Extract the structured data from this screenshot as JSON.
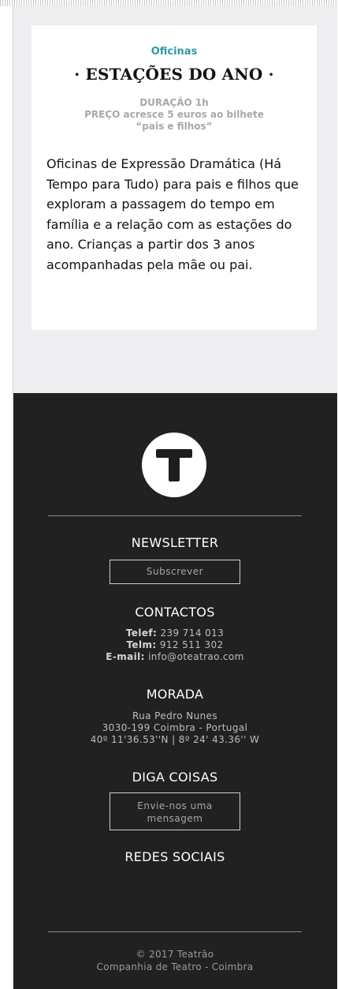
{
  "event": {
    "category": "Oficinas",
    "title": "· ESTAÇÕES DO ANO ·",
    "duration": "DURAÇÃO 1h",
    "price": "PREÇO acresce 5 euros ao bilhete",
    "price_note": "“pais e  filhos”",
    "description": "Oficinas de Expressão Dramática (Há Tempo para Tudo) para pais e filhos que exploram a passagem do tempo em família e a relação com as estações do ano. Crianças a partir dos 3 anos acompanhadas pela mãe ou pai."
  },
  "footer": {
    "logo_letter": "T",
    "newsletter": {
      "heading": "NEWSLETTER",
      "button": "Subscrever"
    },
    "contacts": {
      "heading": "CONTACTOS",
      "phone_label": "Telef:",
      "phone": "239 714 013",
      "mobile_label": "Telm:",
      "mobile": "912 511 302",
      "email_label": "E-mail:",
      "email": "info@oteatrao.com"
    },
    "address": {
      "heading": "MORADA",
      "street": "Rua Pedro Nunes",
      "city": "3030-199 Coimbra - Portugal",
      "coords": "40º 11'36.53''N | 8º 24' 43.36'' W"
    },
    "message": {
      "heading": "DIGA COISAS",
      "button_line1": "Envie-nos uma",
      "button_line2": "mensagem"
    },
    "social": {
      "heading": "REDES SOCIAIS"
    },
    "copyright_line1": "© 2017 Teatrão",
    "copyright_line2": "Companhia de Teatro - Coimbra"
  },
  "colors": {
    "accent": "#2e9aa6",
    "footer_bg": "#212121",
    "content_bg": "#eeeef0"
  }
}
